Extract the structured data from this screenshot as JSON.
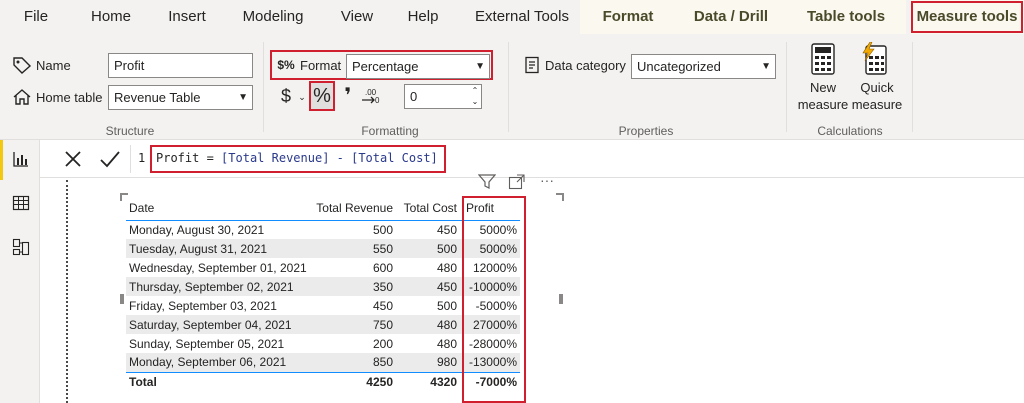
{
  "menu": {
    "tabs": [
      "File",
      "Home",
      "Insert",
      "Modeling",
      "View",
      "Help",
      "External Tools",
      "Format",
      "Data / Drill",
      "Table tools",
      "Measure tools"
    ]
  },
  "ribbon": {
    "structure": {
      "name_label": "Name",
      "name_value": "Profit",
      "home_table_label": "Home table",
      "home_table_value": "Revenue Table",
      "group_title": "Structure"
    },
    "formatting": {
      "format_label": "Format",
      "format_value": "Percentage",
      "currency_symbol": "$",
      "percent_symbol": "%",
      "comma_symbol": "❜",
      "decimal_places": "0",
      "group_title": "Formatting"
    },
    "properties": {
      "data_category_label": "Data category",
      "data_category_value": "Uncategorized",
      "group_title": "Properties"
    },
    "calculations": {
      "new_measure_line1": "New",
      "new_measure_line2": "measure",
      "quick_measure_line1": "Quick",
      "quick_measure_line2": "measure",
      "group_title": "Calculations"
    }
  },
  "formula_bar": {
    "line_number": "1",
    "formula_name": "Profit",
    "formula_eq": " = ",
    "formula_expr": "[Total Revenue] - [Total Cost]"
  },
  "visual_header": {
    "more_label": "···"
  },
  "table": {
    "columns": [
      "Date",
      "Total Revenue",
      "Total Cost",
      "Profit"
    ],
    "rows": [
      [
        "Monday, August 30, 2021",
        "500",
        "450",
        "5000%"
      ],
      [
        "Tuesday, August 31, 2021",
        "550",
        "500",
        "5000%"
      ],
      [
        "Wednesday, September 01, 2021",
        "600",
        "480",
        "12000%"
      ],
      [
        "Thursday, September 02, 2021",
        "350",
        "450",
        "-10000%"
      ],
      [
        "Friday, September 03, 2021",
        "450",
        "500",
        "-5000%"
      ],
      [
        "Saturday, September 04, 2021",
        "750",
        "480",
        "27000%"
      ],
      [
        "Sunday, September 05, 2021",
        "200",
        "480",
        "-28000%"
      ],
      [
        "Monday, September 06, 2021",
        "850",
        "980",
        "-13000%"
      ]
    ],
    "total": [
      "Total",
      "4250",
      "4320",
      "-7000%"
    ]
  },
  "colors": {
    "highlight_red": "#d0202f",
    "accent_blue": "#118dff",
    "nav_selected": "#f2c811"
  }
}
